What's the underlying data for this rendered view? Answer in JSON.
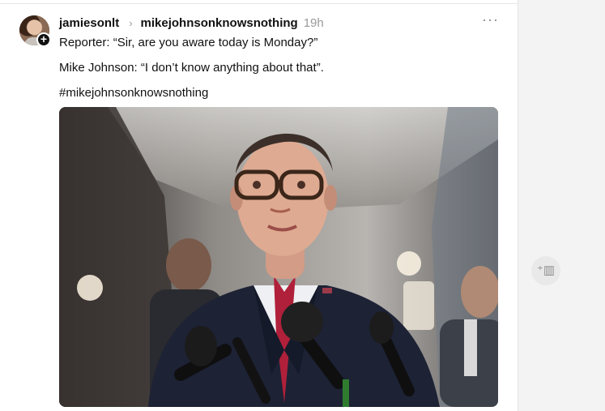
{
  "post": {
    "username": "jamiesonlt",
    "topic": "mikejohnsonknowsnothing",
    "time": "19h",
    "lines": [
      "Reporter: “Sir, are you aware today is Monday?”",
      "Mike Johnson: “I don’t know anything about that”.",
      "#mikejohnsonknowsnothing"
    ],
    "follow_symbol": "+",
    "more_symbol": "···",
    "chevron_symbol": "›"
  },
  "side": {
    "icon_name": "add-column-icon",
    "icon_glyph": "⁺▥"
  },
  "icons": [
    "avatar",
    "follow-plus-icon",
    "chevron-right-icon",
    "more-icon",
    "add-column-icon"
  ]
}
